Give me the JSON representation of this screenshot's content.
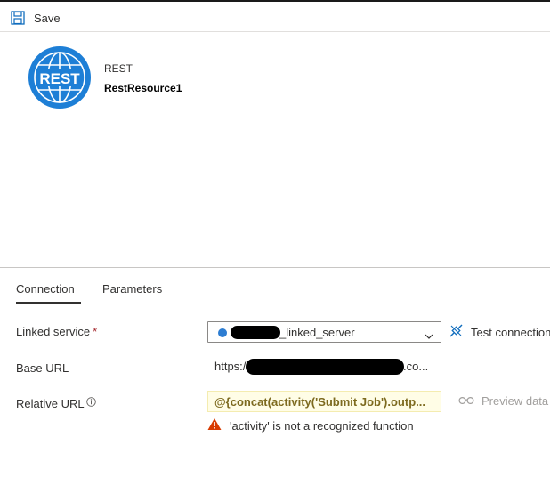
{
  "toolbar": {
    "save_label": "Save",
    "save_icon": "save-icon"
  },
  "resource": {
    "icon_label": "REST",
    "icon_name": "rest-globe-icon",
    "icon_color": "#1e7fd6",
    "type": "REST",
    "name": "RestResource1"
  },
  "tabs": [
    {
      "label": "Connection",
      "active": true
    },
    {
      "label": "Parameters",
      "active": false
    }
  ],
  "form": {
    "linked_service": {
      "label": "Linked service",
      "required_marker": "*",
      "value": "_linked_server",
      "value_redacted": true,
      "test_connection_label": "Test connection",
      "test_icon": "plug-icon"
    },
    "base_url": {
      "label": "Base URL",
      "value_prefix": "https:/",
      "value_suffix": ".co...",
      "value_redacted": true
    },
    "relative_url": {
      "label": "Relative URL",
      "info_icon": "info-icon",
      "value": "@{concat(activity('Submit Job').outp...",
      "preview_label": "Preview data",
      "preview_icon": "glasses-icon",
      "warning": "'activity' is not a recognized function",
      "warning_icon": "warning-icon",
      "warning_color": "#d83b01"
    }
  }
}
